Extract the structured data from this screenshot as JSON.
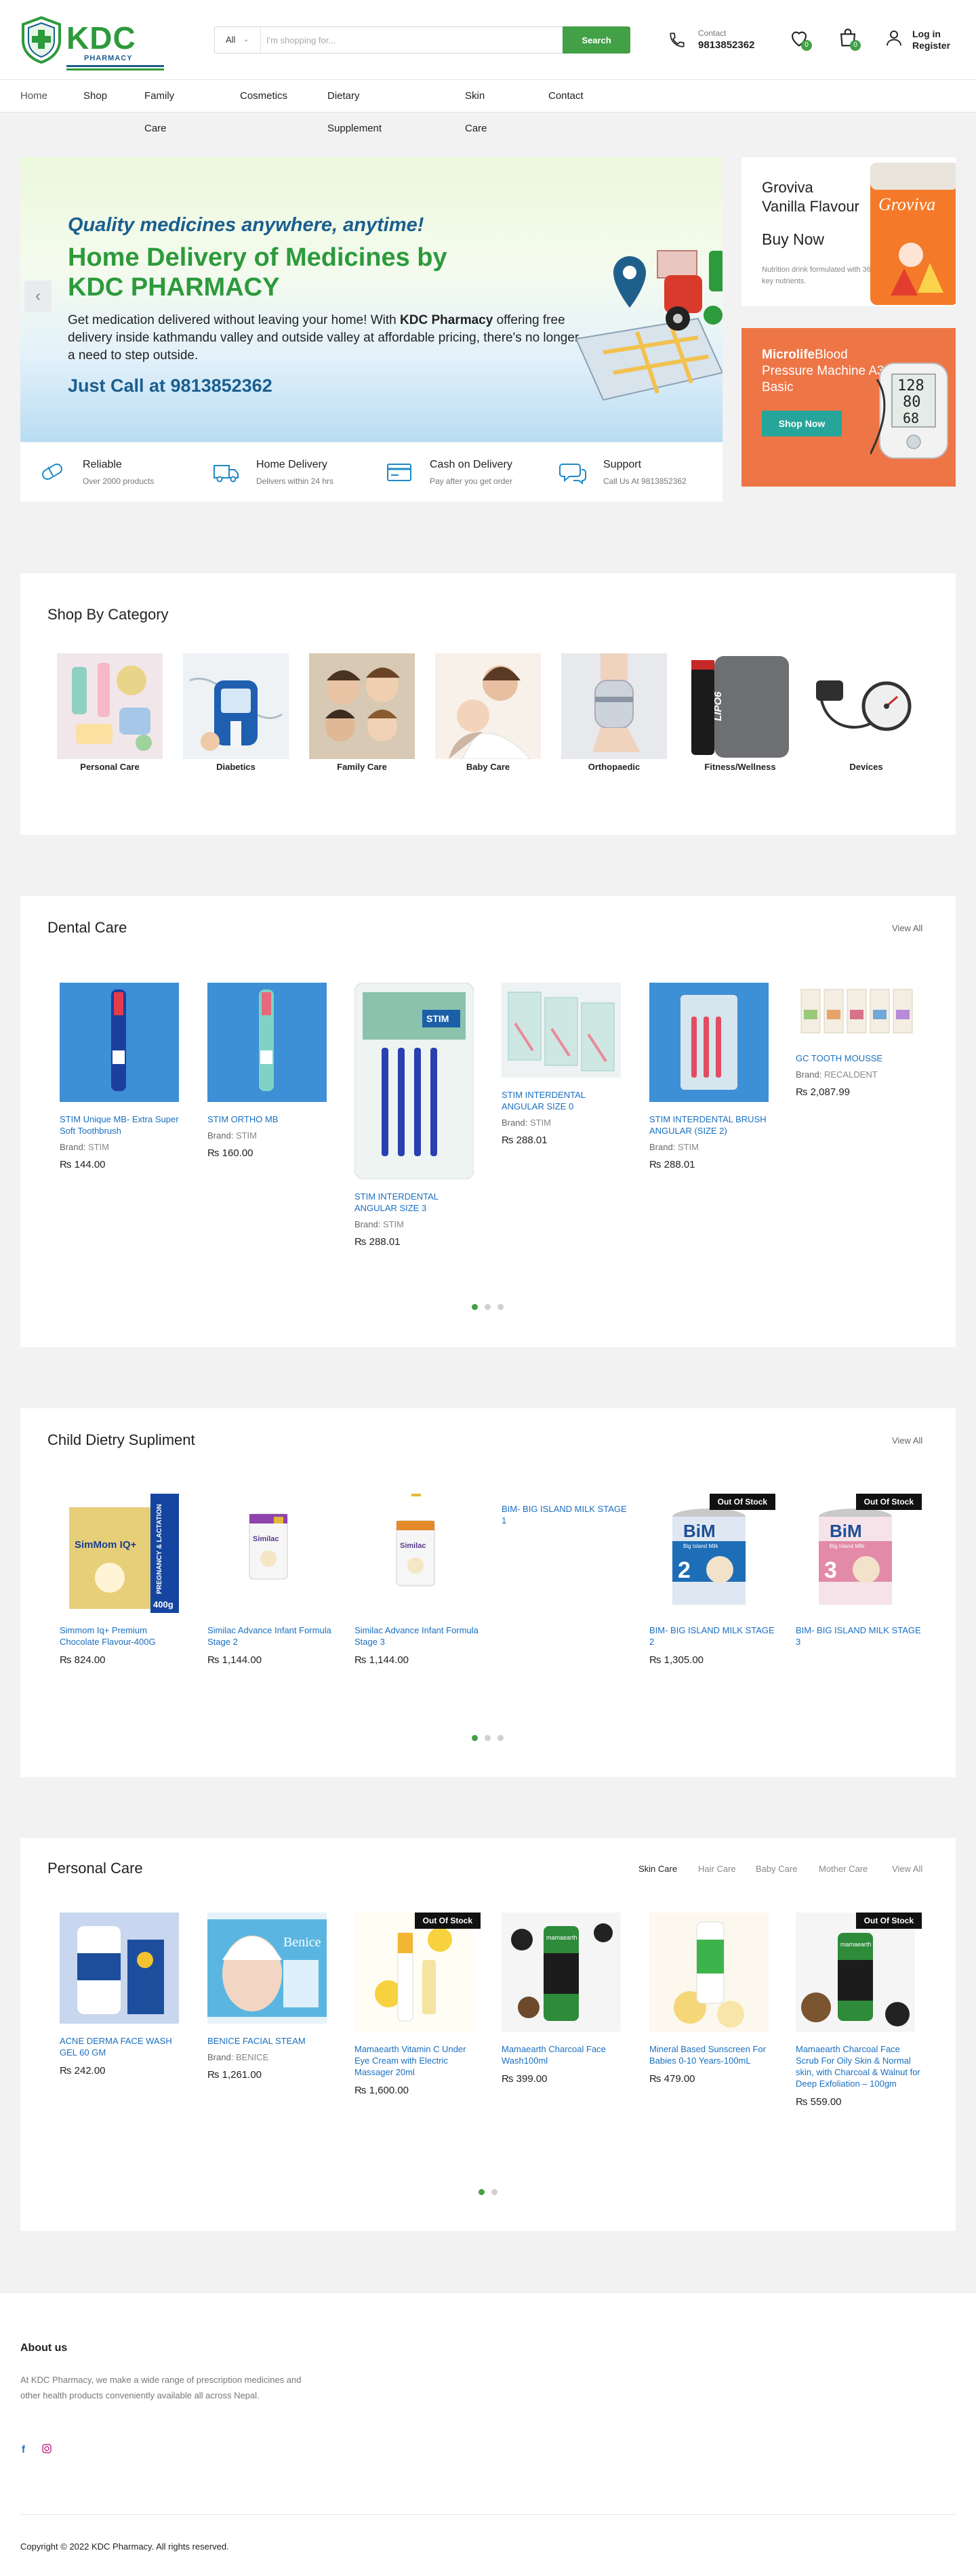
{
  "header": {
    "logo_text": "KDC",
    "logo_sub": "PHARMACY",
    "search_category": "All",
    "search_placeholder": "I'm shopping for...",
    "search_button": "Search",
    "contact_label": "Contact",
    "contact_number": "9813852362",
    "wishlist_count": "0",
    "cart_count": "0",
    "login": "Log in",
    "register": "Register"
  },
  "nav": [
    "Home",
    "Shop",
    "Family Care",
    "Cosmetics",
    "Dietary Supplement",
    "Skin Care",
    "Contact"
  ],
  "hero": {
    "tagline": "Quality medicines anywhere, anytime!",
    "headline_1": "Home Delivery of Medicines by",
    "headline_2": "KDC PHARMACY",
    "desc_1": "Get medication delivered without leaving your home! With ",
    "desc_bold": "KDC Pharmacy",
    "desc_2": " offering free delivery inside kathmandu valley and outside valley at affordable pricing, there's no longer a need to step outside.",
    "call": "Just Call at 9813852362"
  },
  "features": [
    {
      "title": "Reliable",
      "sub": "Over 2000 products"
    },
    {
      "title": "Home Delivery",
      "sub": "Delivers within 24 hrs"
    },
    {
      "title": "Cash on Delivery",
      "sub": "Pay after you get order"
    },
    {
      "title": "Support",
      "sub": "Call Us At 9813852362"
    }
  ],
  "promo1": {
    "line1": "Groviva",
    "line2": "Vanilla Flavour",
    "cta": "Buy Now",
    "note": "Nutrition drink formulated with 36 key nutrients.",
    "pack_text": "Groviva"
  },
  "promo2": {
    "brand": "Microlife",
    "line": "Blood Pressure Machine A3 Basic",
    "cta": "Shop Now",
    "screen": [
      "128",
      "80",
      "68"
    ]
  },
  "categories": {
    "title": "Shop By Category",
    "items": [
      "Personal Care",
      "Diabetics",
      "Family Care",
      "Baby Care",
      "Orthopaedic",
      "Fitness/Wellness",
      "Devices"
    ],
    "lipo_text": "LIPO6"
  },
  "dental": {
    "title": "Dental Care",
    "view_all": "View All",
    "products": [
      {
        "name": "STIM Unique MB- Extra Super Soft Toothbrush",
        "brand_label": "Brand:",
        "brand": "STIM",
        "price": "₨ 144.00"
      },
      {
        "name": "STIM ORTHO MB",
        "brand_label": "Brand:",
        "brand": "STIM",
        "price": "₨ 160.00"
      },
      {
        "name": "STIM INTERDENTAL ANGULAR SIZE 3",
        "brand_label": "Brand:",
        "brand": "STIM",
        "price": "₨ 288.01"
      },
      {
        "name": "STIM INTERDENTAL ANGULAR SIZE 0",
        "brand_label": "Brand:",
        "brand": "STIM",
        "price": "₨ 288.01"
      },
      {
        "name": "STIM INTERDENTAL BRUSH ANGULAR (SIZE 2)",
        "brand_label": "Brand:",
        "brand": "STIM",
        "price": "₨ 288.01"
      },
      {
        "name": "GC TOOTH MOUSSE",
        "brand_label": "Brand:",
        "brand": "RECALDENT",
        "price": "₨ 2,087.99"
      }
    ],
    "pack_text": "STIM"
  },
  "child": {
    "title": "Child Dietry Supliment",
    "view_all": "View All",
    "products": [
      {
        "name": "Simmom Iq+ Premium Chocolate Flavour-400G",
        "price": "₨ 824.00"
      },
      {
        "name": "Similac Advance Infant Formula Stage 2",
        "price": "₨ 1,144.00"
      },
      {
        "name": "Similac Advance Infant Formula Stage 3",
        "price": "₨ 1,144.00"
      },
      {
        "name": "BIM- BIG ISLAND MILK STAGE 1",
        "price": ""
      },
      {
        "name": "BIM- BIG ISLAND MILK STAGE 2",
        "price": "₨ 1,305.00"
      },
      {
        "name": "BIM- BIG ISLAND MILK STAGE 3",
        "price": ""
      }
    ],
    "oos": "Out Of Stock",
    "simmom_text": "SimMom IQ+",
    "simmom_side": "PREGNANCY & LACTATION",
    "simmom_weight": "400g",
    "similac_text": "Similac",
    "bim_text": "BiM",
    "bim_sub": "Big Island Milk",
    "bim_stage2": "2",
    "bim_stage3": "3"
  },
  "personal": {
    "title": "Personal Care",
    "tabs": [
      "Skin Care",
      "Hair Care",
      "Baby Care",
      "Mother Care",
      "View All"
    ],
    "products": [
      {
        "name": "ACNE DERMA FACE WASH GEL 60 GM",
        "brand_label": "",
        "brand": "",
        "price": "₨ 242.00"
      },
      {
        "name": "BENICE FACIAL STEAM",
        "brand_label": "Brand:",
        "brand": "BENICE",
        "price": "₨ 1,261.00"
      },
      {
        "name": "Mamaearth Vitamin C Under Eye Cream with Electric Massager 20ml",
        "brand_label": "",
        "brand": "",
        "price": "₨ 1,600.00"
      },
      {
        "name": "Mamaearth Charcoal Face Wash100ml",
        "brand_label": "",
        "brand": "",
        "price": "₨ 399.00"
      },
      {
        "name": "Mineral Based Sunscreen For Babies 0-10 Years-100mL",
        "brand_label": "",
        "brand": "",
        "price": "₨ 479.00"
      },
      {
        "name": "Mamaearth Charcoal Face Scrub For Oily Skin & Normal skin, with Charcoal & Walnut for Deep Exfoliation – 100gm",
        "brand_label": "",
        "brand": "",
        "price": "₨ 559.00"
      }
    ],
    "oos": "Out Of Stock",
    "benice_text": "Benice",
    "mama_text": "mamaearth"
  },
  "footer": {
    "about_title": "About us",
    "about_text": "At KDC Pharmacy, we make a wide range of prescription medicines and other health products conveniently available all across Nepal.",
    "fb": "f",
    "copyright": "Copyright © 2022 KDC Pharmacy. All rights reserved."
  },
  "colors": {
    "brand_green": "#43a047",
    "brand_blue": "#1b5e8f",
    "link_blue": "#1a6fc0",
    "promo_orange": "#ee7546",
    "teal": "#26a69a"
  }
}
